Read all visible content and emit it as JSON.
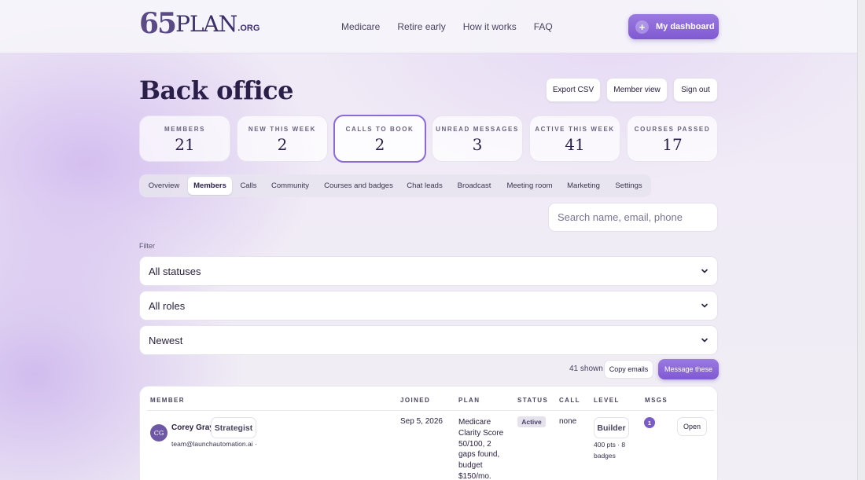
{
  "brand": {
    "logo_number": "65",
    "logo_word": "PLAN",
    "logo_suffix": ".ORG",
    "accent": "#8b6ad8"
  },
  "nav": {
    "items": [
      "Medicare",
      "Retire early",
      "How it works",
      "FAQ"
    ],
    "dashboard_button": "My dashboard",
    "dashboard_icon": "plus-icon"
  },
  "page": {
    "title": "Back office"
  },
  "header_actions": {
    "export_csv": "Export CSV",
    "member_view": "Member view",
    "sign_out": "Sign out"
  },
  "stats": [
    {
      "label": "Members",
      "value": "21"
    },
    {
      "label": "New this week",
      "value": "2"
    },
    {
      "label": "Calls to book",
      "value": "2"
    },
    {
      "label": "Unread messages",
      "value": "3"
    },
    {
      "label": "Active this week",
      "value": "41"
    },
    {
      "label": "Courses passed",
      "value": "17"
    }
  ],
  "tabs": [
    "Overview",
    "Members",
    "Calls",
    "Community",
    "Courses and badges",
    "Chat leads",
    "Broadcast",
    "Meeting room",
    "Marketing",
    "Settings"
  ],
  "active_tab": "Members",
  "search": {
    "placeholder": "Search name, email, phone",
    "value": ""
  },
  "filters": {
    "label": "Filter",
    "status": "All statuses",
    "role": "All roles",
    "sort": "Newest"
  },
  "results": {
    "shown": "41 shown",
    "copy_emails": "Copy emails",
    "message_these": "Message these"
  },
  "table": {
    "headers": {
      "member": "Member",
      "joined": "Joined",
      "plan": "Plan",
      "status": "Status",
      "call": "Call",
      "level": "Level",
      "msgs": "Msgs"
    },
    "rows": [
      {
        "initials": "CG",
        "name": "Corey Gray",
        "role": "Strategist",
        "email": "team@launchautomation.ai ·",
        "joined": "Sep 5, 2026",
        "plan_lines": [
          "Medicare",
          "Clarity Score",
          "50/100, 2",
          "gaps found,",
          "budget",
          "$150/mo."
        ],
        "status": "Active",
        "call": "none",
        "level": "Builder",
        "level_detail_lines": [
          "400 pts · 8",
          "badges"
        ],
        "msgs": "1",
        "open_label": "Open"
      }
    ]
  }
}
